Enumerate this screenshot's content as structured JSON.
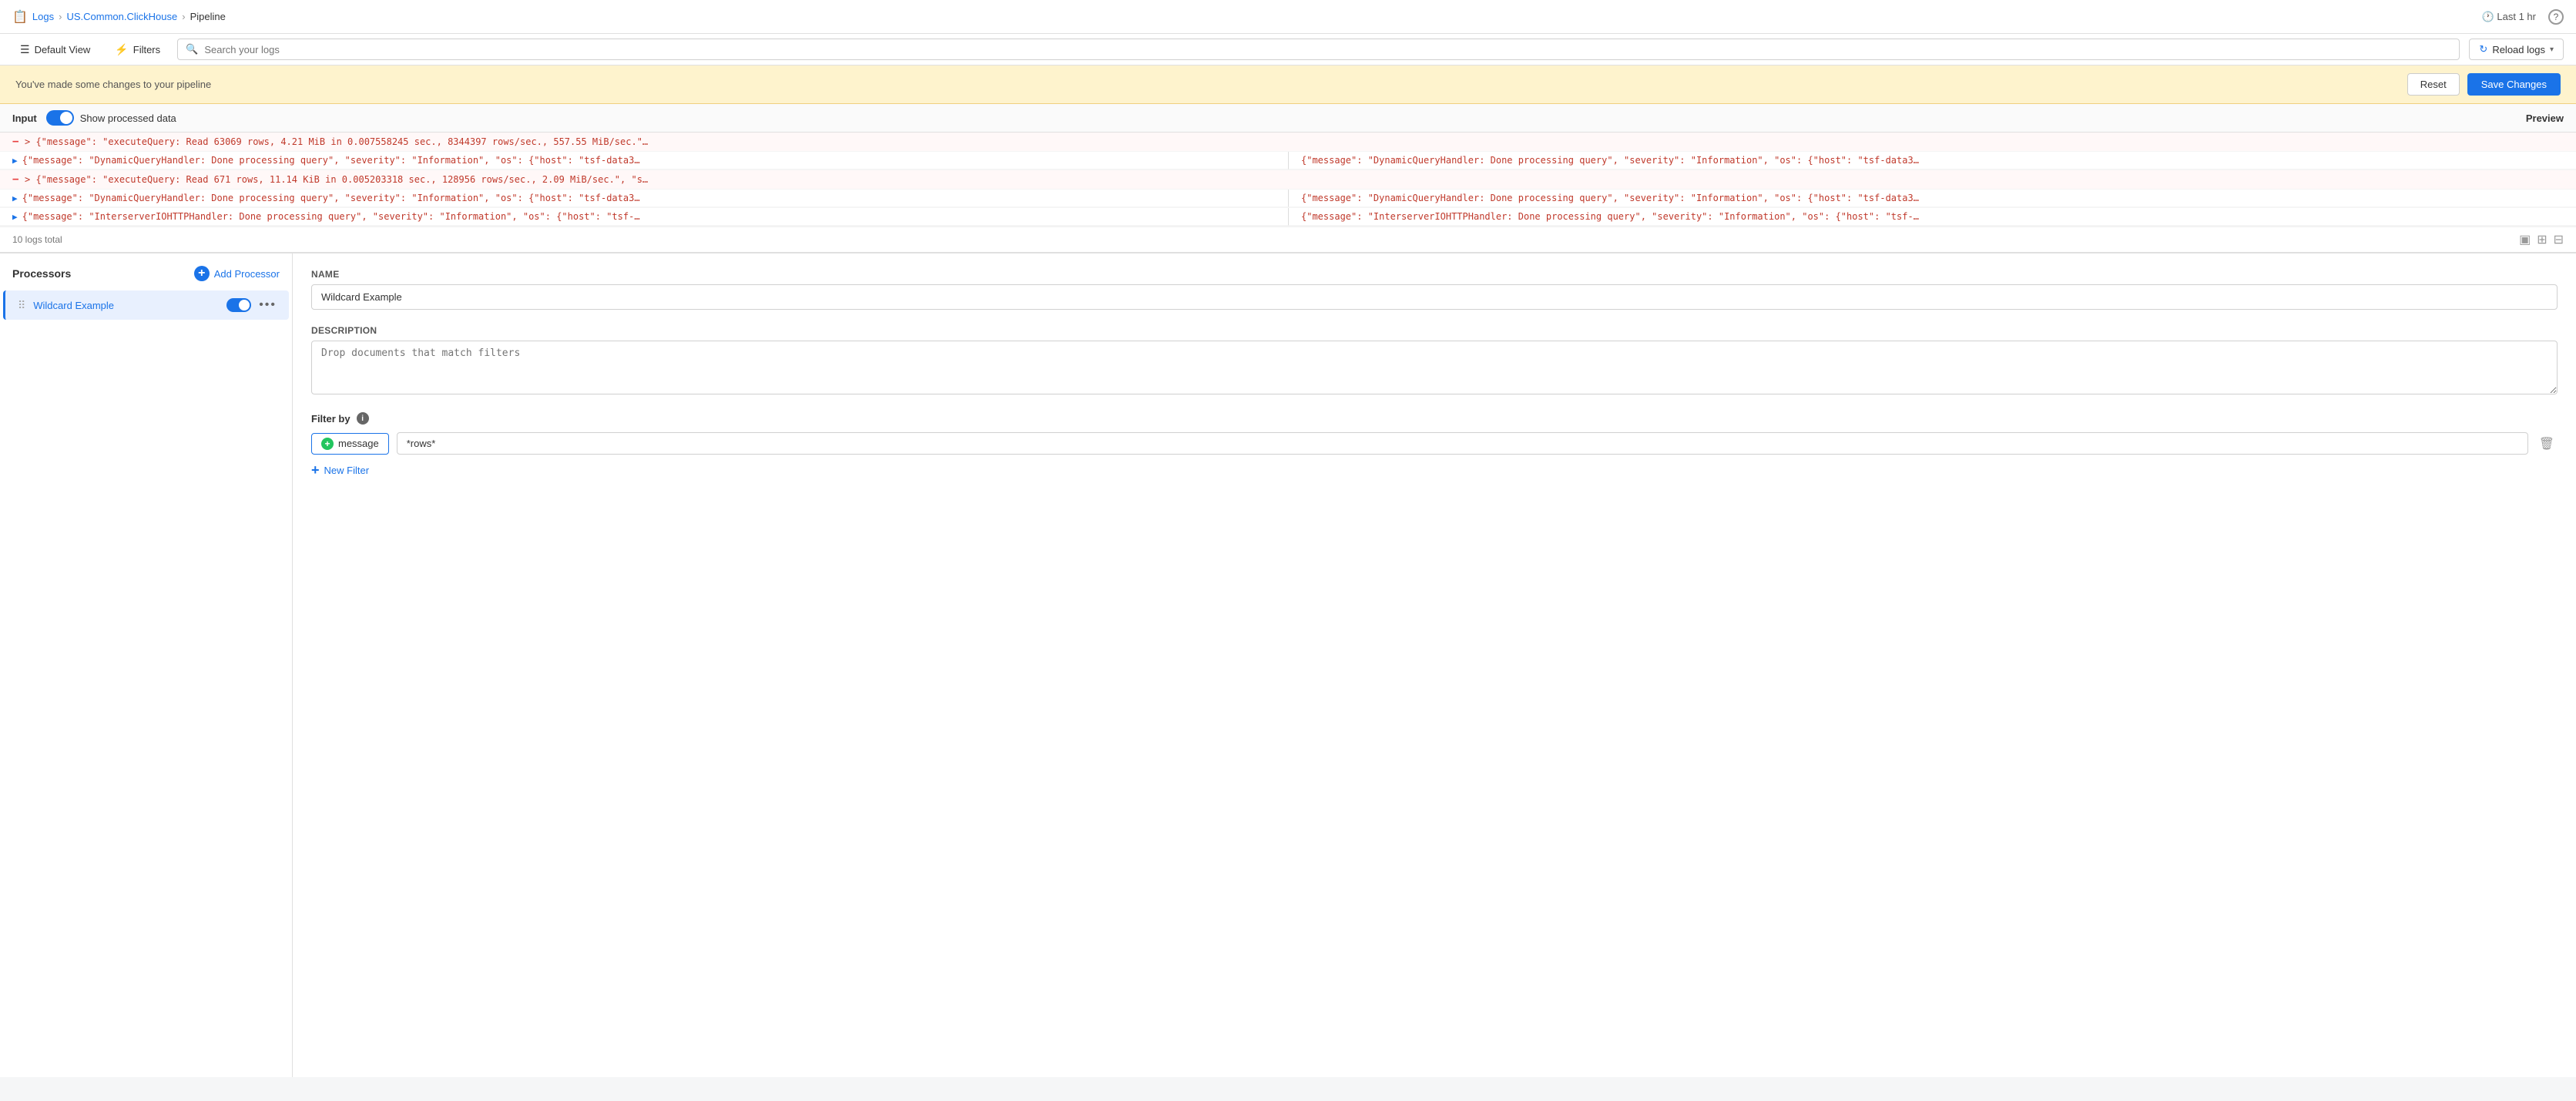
{
  "nav": {
    "icon": "📄",
    "breadcrumb": [
      "Logs",
      "US.Common.ClickHouse",
      "Pipeline"
    ],
    "time_label": "Last 1 hr",
    "help_icon": "?"
  },
  "toolbar": {
    "default_view_label": "Default View",
    "filters_label": "Filters",
    "search_placeholder": "Search your logs",
    "reload_label": "Reload logs"
  },
  "banner": {
    "message": "You've made some changes to your pipeline",
    "reset_label": "Reset",
    "save_label": "Save Changes"
  },
  "log_area": {
    "input_label": "Input",
    "toggle_label": "Show processed data",
    "preview_label": "Preview",
    "total_logs": "10 logs total",
    "rows": [
      {
        "id": 1,
        "type": "minus",
        "left_text": "{\"message\": \"executeQuery: Read 63069 rows, 4.21 MiB in 0.007558245 sec., 8344397 rows/sec., 557.55 MiB/sec.\"…",
        "right_text": ""
      },
      {
        "id": 2,
        "type": "expand",
        "left_text": "{\"message\": \"DynamicQueryHandler: Done processing query\", \"severity\": \"Information\", \"os\": {\"host\": \"tsf-data3…",
        "right_text": "{\"message\": \"DynamicQueryHandler: Done processing query\", \"severity\": \"Information\", \"os\": {\"host\": \"tsf-data3…"
      },
      {
        "id": 3,
        "type": "minus",
        "left_text": "{\"message\": \"executeQuery: Read 671 rows, 11.14 KiB in 0.005203318 sec., 128956 rows/sec., 2.09 MiB/sec.\", \"s…",
        "right_text": ""
      },
      {
        "id": 4,
        "type": "expand",
        "left_text": "{\"message\": \"DynamicQueryHandler: Done processing query\", \"severity\": \"Information\", \"os\": {\"host\": \"tsf-data3…",
        "right_text": "{\"message\": \"DynamicQueryHandler: Done processing query\", \"severity\": \"Information\", \"os\": {\"host\": \"tsf-data3…"
      },
      {
        "id": 5,
        "type": "expand",
        "left_text": "{\"message\": \"InterserverIOHTTPHandler: Done processing query\", \"severity\": \"Information\", \"os\": {\"host\": \"tsf-…",
        "right_text": "{\"message\": \"InterserverIOHTTPHandler: Done processing query\", \"severity\": \"Information\", \"os\": {\"host\": \"tsf-…"
      }
    ]
  },
  "processors": {
    "title": "Processors",
    "add_label": "Add Processor",
    "items": [
      {
        "id": 1,
        "name": "Wildcard Example",
        "enabled": true
      }
    ]
  },
  "detail": {
    "name_label": "Name",
    "name_value": "Wildcard Example",
    "description_label": "Description",
    "description_placeholder": "Drop documents that match filters",
    "filter_by_label": "Filter by",
    "filters": [
      {
        "field": "message",
        "value": "*rows*"
      }
    ],
    "new_filter_label": "New Filter"
  }
}
